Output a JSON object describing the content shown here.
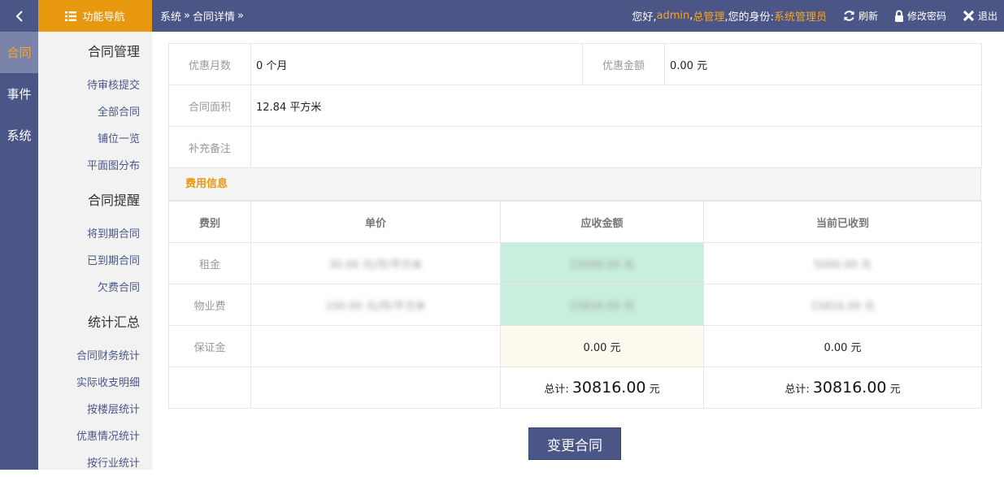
{
  "topbar": {
    "nav_label": "功能导航",
    "breadcrumb": [
      "系统",
      "合同详情"
    ],
    "breadcrumb_sep": "»",
    "greeting": "您好,",
    "username": "admin",
    "org_sep": ",",
    "org": "总管理",
    "role_prefix": ",您的身份:",
    "role": "系统管理员",
    "refresh_label": "刷新",
    "password_label": "修改密码",
    "logout_label": "退出"
  },
  "mainnav": [
    {
      "label": "合同",
      "active": true
    },
    {
      "label": "事件",
      "active": false
    },
    {
      "label": "系统",
      "active": false
    }
  ],
  "submenu": {
    "groups": [
      {
        "title": "合同管理",
        "items": [
          "待审核提交",
          "全部合同",
          "铺位一览",
          "平面图分布"
        ]
      },
      {
        "title": "合同提醒",
        "items": [
          "将到期合同",
          "已到期合同",
          "欠费合同"
        ]
      },
      {
        "title": "统计汇总",
        "items": [
          "合同财务统计",
          "实际收支明细",
          "按楼层统计",
          "优惠情况统计",
          "按行业统计"
        ]
      }
    ]
  },
  "info": {
    "discount_months_label": "优惠月数",
    "discount_months_value": "0 个月",
    "discount_amount_label": "优惠金额",
    "discount_amount_value": "0.00 元",
    "area_label": "合同面积",
    "area_value": "12.84 平方米",
    "remark_label": "补充备注",
    "remark_value": ""
  },
  "fee": {
    "section_title": "费用信息",
    "headers": [
      "费别",
      "单价",
      "应收金额",
      "当前已收到"
    ],
    "rows": [
      {
        "name": "租金",
        "price": "30.00 元/月/平方米",
        "receivable": "15000.00 元",
        "received": "5000.00 元"
      },
      {
        "name": "物业费",
        "price": "100.00 元/月/平方米",
        "receivable": "15816.00 元",
        "received": "15816.00 元"
      },
      {
        "name": "保证金",
        "price": "",
        "receivable": "0.00 元",
        "received": "0.00 元"
      }
    ],
    "total_label": "总计:",
    "total_receivable": "30816.00",
    "total_received": "30816.00",
    "unit": "元"
  },
  "actions": {
    "change_contract": "变更合同"
  },
  "colors": {
    "brand": "#4b5687",
    "accent": "#e8980f",
    "receivable_bg": "#c8eedd"
  }
}
